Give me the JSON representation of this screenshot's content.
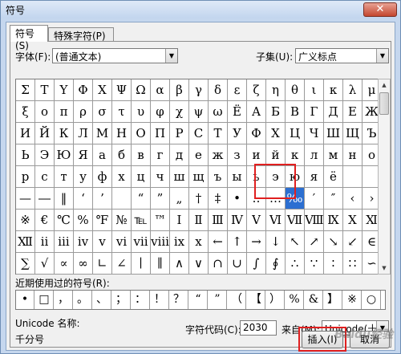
{
  "window": {
    "title": "符号",
    "close_glyph": "✕"
  },
  "tabs": [
    {
      "label": "符号(S)"
    },
    {
      "label": "特殊字符(P)"
    }
  ],
  "font": {
    "label": "字体(F):",
    "value": "(普通文本)"
  },
  "subset": {
    "label": "子集(U):",
    "value": "广义标点"
  },
  "grid": {
    "rows": [
      [
        "Σ",
        "Τ",
        "Υ",
        "Φ",
        "Χ",
        "Ψ",
        "Ω",
        "α",
        "β",
        "γ",
        "δ",
        "ε",
        "ζ",
        "η",
        "θ",
        "ι",
        "κ",
        "λ",
        "μ"
      ],
      [
        "ξ",
        "ο",
        "π",
        "ρ",
        "σ",
        "τ",
        "υ",
        "φ",
        "χ",
        "ψ",
        "ω",
        "Ё",
        "А",
        "Б",
        "В",
        "Г",
        "Д",
        "Е",
        "Ж"
      ],
      [
        "И",
        "Й",
        "К",
        "Л",
        "М",
        "Н",
        "О",
        "П",
        "Р",
        "С",
        "Т",
        "У",
        "Ф",
        "Х",
        "Ц",
        "Ч",
        "Ш",
        "Щ",
        "Ъ"
      ],
      [
        "Ь",
        "Э",
        "Ю",
        "Я",
        "а",
        "б",
        "в",
        "г",
        "д",
        "е",
        "ж",
        "з",
        "и",
        "й",
        "к",
        "л",
        "м",
        "н",
        "о"
      ],
      [
        "р",
        "с",
        "т",
        "у",
        "ф",
        "х",
        "ц",
        "ч",
        "ш",
        "щ",
        "ъ",
        "ы",
        "ь",
        "э",
        "ю",
        "я",
        "ё",
        "",
        ""
      ],
      [
        "—",
        "―",
        "‖",
        "‘",
        "’",
        "",
        "“",
        "”",
        "„",
        "†",
        "‡",
        "•",
        "‥",
        "…",
        "‰",
        "′",
        "″",
        "‹",
        "›"
      ],
      [
        "※",
        "€",
        "℃",
        "%",
        "℉",
        "№",
        "℡",
        "™",
        "Ⅰ",
        "Ⅱ",
        "Ⅲ",
        "Ⅳ",
        "Ⅴ",
        "Ⅵ",
        "Ⅶ",
        "Ⅷ",
        "Ⅸ",
        "Ⅹ",
        "Ⅺ"
      ],
      [
        "Ⅻ",
        "ⅱ",
        "ⅲ",
        "ⅳ",
        "ⅴ",
        "ⅵ",
        "ⅶ",
        "ⅷ",
        "ⅸ",
        "ⅹ",
        "←",
        "↑",
        "→",
        "↓",
        "↖",
        "↗",
        "↘",
        "↙",
        "∈"
      ],
      [
        "∑",
        "√",
        "∝",
        "∞",
        "∟",
        "∠",
        "∣",
        "∥",
        "∧",
        "∨",
        "∩",
        "∪",
        "∫",
        "∮",
        "∴",
        "∵",
        "∶",
        "∷",
        "∽"
      ]
    ],
    "selected": "‰"
  },
  "recent": {
    "label": "近期使用过的符号(R):",
    "symbols": [
      "•",
      "□",
      "，",
      "。",
      "、",
      "；",
      "：",
      "！",
      "？",
      "“",
      "”",
      "（",
      "【",
      "）",
      "%",
      "&",
      "】",
      "※",
      "○"
    ]
  },
  "unicode": {
    "name_label": "Unicode 名称:",
    "name_value": "千分号"
  },
  "char_code": {
    "label": "字符代码(C):",
    "value": "2030"
  },
  "from": {
    "label": "来自(M):",
    "value": "Unicode(十六进制)"
  },
  "buttons": {
    "insert": "插入(I)",
    "cancel": "取消"
  },
  "watermark": "Baidu经验"
}
